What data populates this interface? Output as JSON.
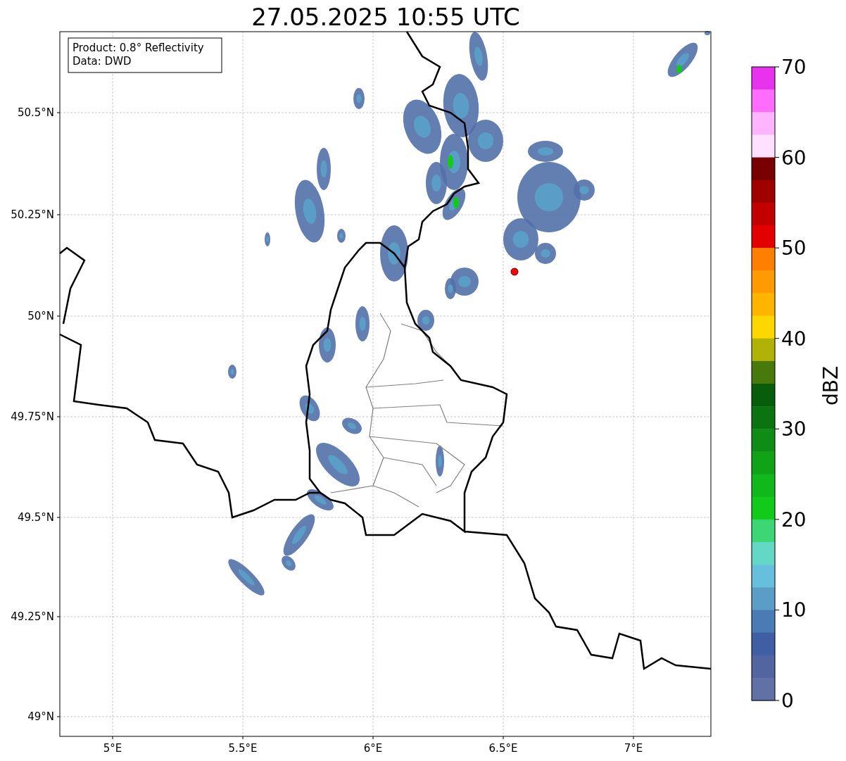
{
  "title": "27.05.2025 10:55 UTC",
  "annotation": [
    "Product: 0.8° Reflectivity",
    "Data: DWD"
  ],
  "y_axis": {
    "ticks": [
      "50.5°N",
      "50.25°N",
      "50°N",
      "49.75°N",
      "49.5°N",
      "49.25°N",
      "49°N"
    ]
  },
  "x_axis": {
    "ticks": [
      "5°E",
      "5.5°E",
      "6°E",
      "6.5°E",
      "7°E"
    ]
  },
  "colorbar": {
    "label": "dBZ",
    "ticks": [
      "70",
      "60",
      "50",
      "40",
      "30",
      "20",
      "10",
      "0"
    ],
    "segments": [
      {
        "color": "#e832ef"
      },
      {
        "color": "#ff6cff"
      },
      {
        "color": "#ffb4ff"
      },
      {
        "color": "#ffe0ff"
      },
      {
        "color": "#780000"
      },
      {
        "color": "#a10000"
      },
      {
        "color": "#c20000"
      },
      {
        "color": "#e20000"
      },
      {
        "color": "#ff7f00"
      },
      {
        "color": "#ff9b00"
      },
      {
        "color": "#ffb400"
      },
      {
        "color": "#ffd700"
      },
      {
        "color": "#b0b207"
      },
      {
        "color": "#477a0a"
      },
      {
        "color": "#085d0c"
      },
      {
        "color": "#0b7410"
      },
      {
        "color": "#0e8c15"
      },
      {
        "color": "#10a318"
      },
      {
        "color": "#11b81c"
      },
      {
        "color": "#12ca1a"
      },
      {
        "color": "#3dd675"
      },
      {
        "color": "#62d8c5"
      },
      {
        "color": "#66c0dd"
      },
      {
        "color": "#5a9ec8"
      },
      {
        "color": "#4b7bb4"
      },
      {
        "color": "#405ea3"
      },
      {
        "color": "#5265a0"
      },
      {
        "color": "#6271a5"
      }
    ]
  }
}
